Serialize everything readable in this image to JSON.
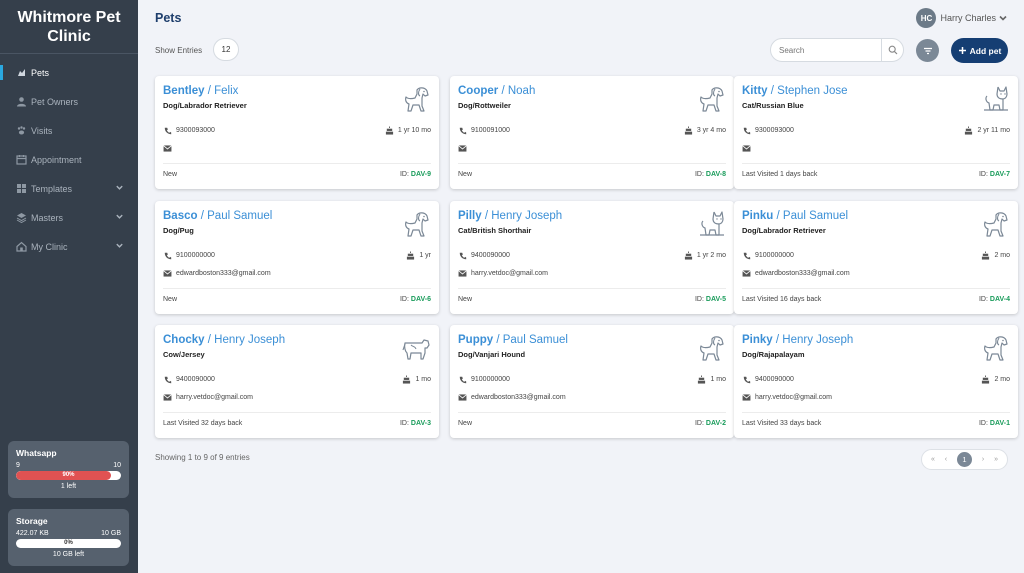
{
  "brand": {
    "line1": "Whitmore Pet",
    "line2": "Clinic"
  },
  "nav": [
    {
      "label": "Pets",
      "icon": "pets-icon",
      "active": true,
      "chevron": false
    },
    {
      "label": "Pet Owners",
      "icon": "user-icon",
      "active": false,
      "chevron": false
    },
    {
      "label": "Visits",
      "icon": "paw-icon",
      "active": false,
      "chevron": false
    },
    {
      "label": "Appointment",
      "icon": "calendar-icon",
      "active": false,
      "chevron": false
    },
    {
      "label": "Templates",
      "icon": "grid-icon",
      "active": false,
      "chevron": true
    },
    {
      "label": "Masters",
      "icon": "layers-icon",
      "active": false,
      "chevron": true
    },
    {
      "label": "My Clinic",
      "icon": "home-icon",
      "active": false,
      "chevron": true
    }
  ],
  "whatsapp": {
    "title": "Whatsapp",
    "used": "9",
    "total": "10",
    "percent_label": "90%",
    "percent": 90,
    "remaining": "1 left",
    "color": "#e05252"
  },
  "storage": {
    "title": "Storage",
    "used": "422.07 KB",
    "total": "10 GB",
    "percent_label": "0%",
    "percent": 0,
    "remaining": "10 GB left"
  },
  "header": {
    "title": "Pets",
    "user_initials": "HC",
    "user_name": "Harry Charles"
  },
  "toolbar": {
    "show_label": "Show Entries",
    "show_value": "12",
    "search_placeholder": "Search",
    "add_label": "Add pet"
  },
  "pets": [
    {
      "pet": "Bentley",
      "owner": "Felix",
      "breed": "Dog/Labrador Retriever",
      "phone": "9300093000",
      "age": "1 yr 10 mo",
      "email": "",
      "status": "New",
      "id_label": "ID:",
      "id": "DAV-9",
      "animal": "dog"
    },
    {
      "pet": "Cooper",
      "owner": "Noah",
      "breed": "Dog/Rottweiler",
      "phone": "9100091000",
      "age": "3 yr 4 mo",
      "email": "",
      "status": "New",
      "id_label": "ID:",
      "id": "DAV-8",
      "animal": "dog"
    },
    {
      "pet": "Kitty",
      "owner": "Stephen Jose",
      "breed": "Cat/Russian Blue",
      "phone": "9300093000",
      "age": "2 yr 11 mo",
      "email": "",
      "status": "Last Visited 1 days back",
      "id_label": "ID:",
      "id": "DAV-7",
      "animal": "cat"
    },
    {
      "pet": "Basco",
      "owner": "Paul Samuel",
      "breed": "Dog/Pug",
      "phone": "9100000000",
      "age": "1 yr",
      "email": "edwardboston333@gmail.com",
      "status": "New",
      "id_label": "ID:",
      "id": "DAV-6",
      "animal": "dog"
    },
    {
      "pet": "Pilly",
      "owner": "Henry Joseph",
      "breed": "Cat/British Shorthair",
      "phone": "9400090000",
      "age": "1 yr 2 mo",
      "email": "harry.vetdoc@gmail.com",
      "status": "New",
      "id_label": "ID:",
      "id": "DAV-5",
      "animal": "cat"
    },
    {
      "pet": "Pinku",
      "owner": "Paul Samuel",
      "breed": "Dog/Labrador Retriever",
      "phone": "9100000000",
      "age": "2 mo",
      "email": "edwardboston333@gmail.com",
      "status": "Last Visited 16 days back",
      "id_label": "ID:",
      "id": "DAV-4",
      "animal": "dog"
    },
    {
      "pet": "Chocky",
      "owner": "Henry Joseph",
      "breed": "Cow/Jersey",
      "phone": "9400090000",
      "age": "1 mo",
      "email": "harry.vetdoc@gmail.com",
      "status": "Last Visited 32 days back",
      "id_label": "ID:",
      "id": "DAV-3",
      "animal": "cow"
    },
    {
      "pet": "Puppy",
      "owner": "Paul Samuel",
      "breed": "Dog/Vanjari Hound",
      "phone": "9100000000",
      "age": "1 mo",
      "email": "edwardboston333@gmail.com",
      "status": "New",
      "id_label": "ID:",
      "id": "DAV-2",
      "animal": "dog"
    },
    {
      "pet": "Pinky",
      "owner": "Henry Joseph",
      "breed": "Dog/Rajapalayam",
      "phone": "9400090000",
      "age": "2 mo",
      "email": "harry.vetdoc@gmail.com",
      "status": "Last Visited 33 days back",
      "id_label": "ID:",
      "id": "DAV-1",
      "animal": "dog"
    }
  ],
  "footer": {
    "showing": "Showing 1 to 9 of 9 entries"
  },
  "pagination": {
    "first": "«",
    "prev": "‹",
    "current": "1",
    "next": "›",
    "last": "»"
  },
  "colors": {
    "sidebar": "#353f4b",
    "accent": "#2aa8e0",
    "primary": "#153e73",
    "link": "#3b8fd6",
    "id": "#1a9c5b"
  }
}
